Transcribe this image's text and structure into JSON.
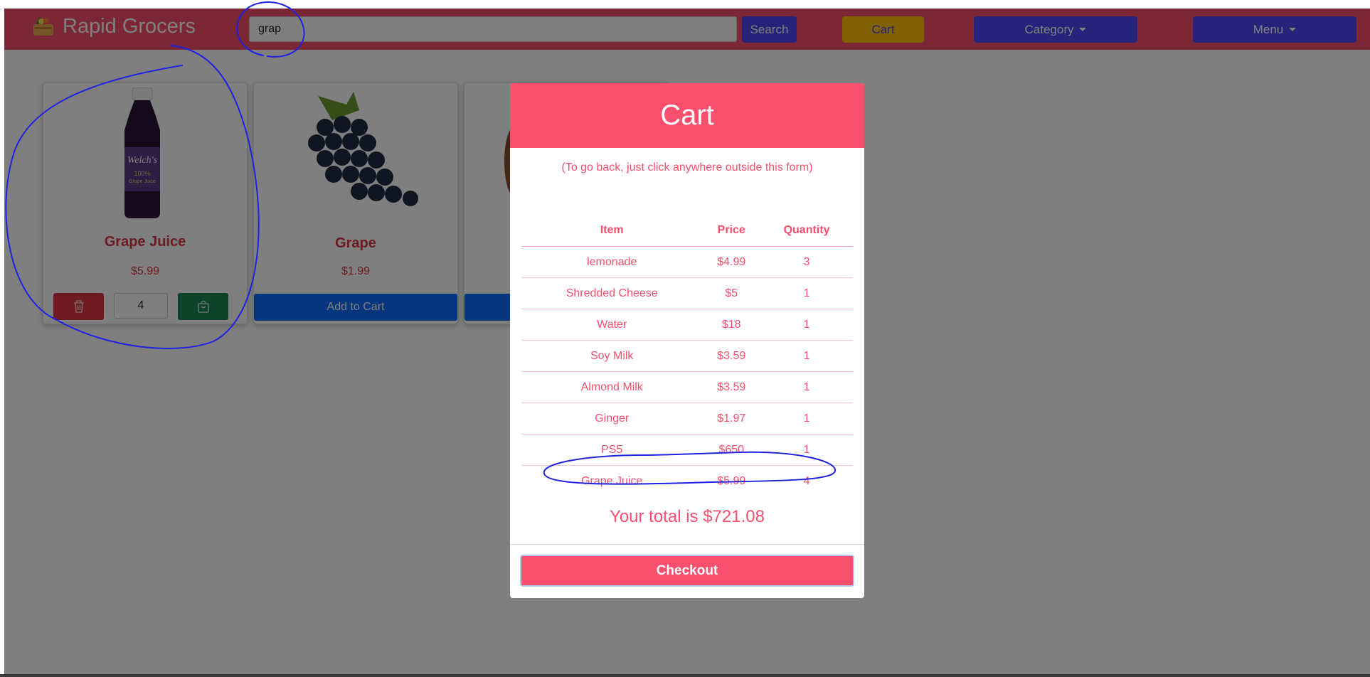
{
  "navbar": {
    "brand": "Rapid Grocers",
    "search_value": "grap",
    "search_button": "Search",
    "cart_button": "Cart",
    "category_button": "Category",
    "menu_button": "Menu"
  },
  "products": [
    {
      "name": "Grape Juice",
      "price": "$5.99",
      "quantity": "4",
      "in_cart": true
    },
    {
      "name": "Grape",
      "price": "$1.99",
      "add_label": "Add to Cart",
      "in_cart": false
    }
  ],
  "cart_modal": {
    "title": "Cart",
    "hint": "(To go back, just click anywhere outside this form)",
    "columns": [
      "Item",
      "Price",
      "Quantity"
    ],
    "rows": [
      {
        "item": "lemonade",
        "price": "$4.99",
        "qty": "3"
      },
      {
        "item": "Shredded Cheese",
        "price": "$5",
        "qty": "1"
      },
      {
        "item": "Water",
        "price": "$18",
        "qty": "1"
      },
      {
        "item": "Soy Milk",
        "price": "$3.59",
        "qty": "1"
      },
      {
        "item": "Almond Milk",
        "price": "$3.59",
        "qty": "1"
      },
      {
        "item": "Ginger",
        "price": "$1.97",
        "qty": "1"
      },
      {
        "item": "PS5",
        "price": "$650",
        "qty": "1"
      },
      {
        "item": "Grape Juice",
        "price": "$5.99",
        "qty": "4"
      }
    ],
    "total": "Your total is $721.08",
    "checkout": "Checkout"
  },
  "colors": {
    "brand_pink": "#f74f6d",
    "primary_blue": "#4e44f5",
    "cart_yellow": "#ffc107",
    "add_blue": "#0d6efd",
    "danger_red": "#dc3545",
    "success_green": "#198754",
    "annotation_ink": "#1f22e0"
  },
  "icons": [
    "basket-icon",
    "trash-icon",
    "bag-icon",
    "caret-down-icon"
  ]
}
